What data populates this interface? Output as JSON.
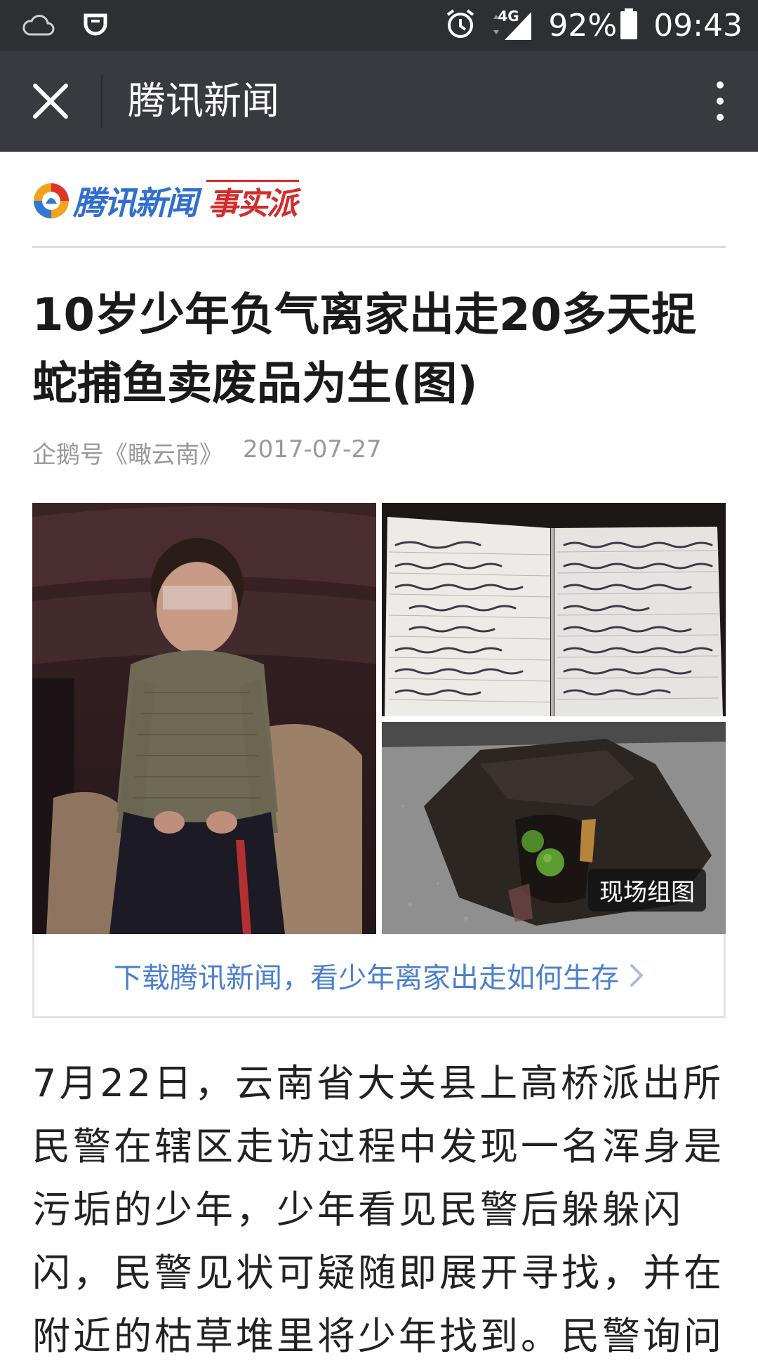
{
  "status_bar": {
    "battery_text": "92%",
    "time": "09:43",
    "network": "4G",
    "icons": [
      "weather-cloud-icon",
      "app-notification-icon",
      "alarm-icon",
      "signal-icon",
      "battery-icon"
    ]
  },
  "nav": {
    "title": "腾讯新闻",
    "close_icon": "close-icon",
    "more_icon": "more-vertical-icon"
  },
  "article": {
    "logo_text": "腾讯新闻",
    "logo_sub": "事实派",
    "headline": "10岁少年负气离家出走20多天捉蛇捕鱼卖废品为生(图)",
    "source": "企鹅号《瞰云南》",
    "date": "2017-07-27",
    "photo_caption": "现场组图",
    "download_banner": "下载腾讯新闻，看少年离家出走如何生存",
    "body": "7月22日，云南省大关县上高桥派出所民警在辖区走访过程中发现一名浑身是污垢的少年，少年看见民警后躲躲闪闪，民警见状可疑随即展开寻找，并在附近的枯草堆里将少年找到。民警询问"
  },
  "colors": {
    "status_bar_bg": "#2e2f33",
    "nav_bg": "#393a3f",
    "link_blue": "#4a7fcf",
    "logo_blue": "#2f6fd0",
    "logo_red": "#d42c2c"
  }
}
